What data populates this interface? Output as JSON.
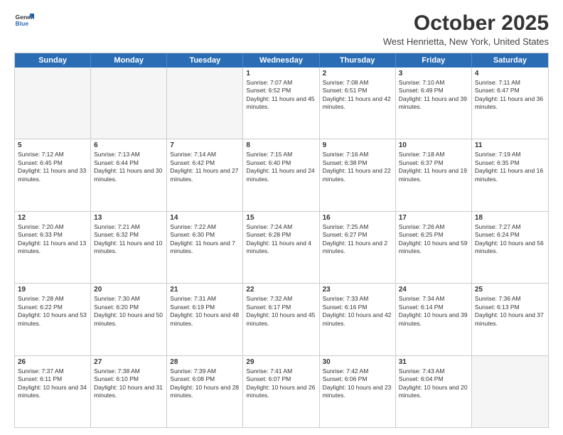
{
  "logo": {
    "line1": "General",
    "line2": "Blue"
  },
  "title": "October 2025",
  "location": "West Henrietta, New York, United States",
  "days_of_week": [
    "Sunday",
    "Monday",
    "Tuesday",
    "Wednesday",
    "Thursday",
    "Friday",
    "Saturday"
  ],
  "weeks": [
    [
      {
        "day": "",
        "text": ""
      },
      {
        "day": "",
        "text": ""
      },
      {
        "day": "",
        "text": ""
      },
      {
        "day": "1",
        "text": "Sunrise: 7:07 AM\nSunset: 6:52 PM\nDaylight: 11 hours and 45 minutes."
      },
      {
        "day": "2",
        "text": "Sunrise: 7:08 AM\nSunset: 6:51 PM\nDaylight: 11 hours and 42 minutes."
      },
      {
        "day": "3",
        "text": "Sunrise: 7:10 AM\nSunset: 6:49 PM\nDaylight: 11 hours and 39 minutes."
      },
      {
        "day": "4",
        "text": "Sunrise: 7:11 AM\nSunset: 6:47 PM\nDaylight: 11 hours and 36 minutes."
      }
    ],
    [
      {
        "day": "5",
        "text": "Sunrise: 7:12 AM\nSunset: 6:45 PM\nDaylight: 11 hours and 33 minutes."
      },
      {
        "day": "6",
        "text": "Sunrise: 7:13 AM\nSunset: 6:44 PM\nDaylight: 11 hours and 30 minutes."
      },
      {
        "day": "7",
        "text": "Sunrise: 7:14 AM\nSunset: 6:42 PM\nDaylight: 11 hours and 27 minutes."
      },
      {
        "day": "8",
        "text": "Sunrise: 7:15 AM\nSunset: 6:40 PM\nDaylight: 11 hours and 24 minutes."
      },
      {
        "day": "9",
        "text": "Sunrise: 7:16 AM\nSunset: 6:38 PM\nDaylight: 11 hours and 22 minutes."
      },
      {
        "day": "10",
        "text": "Sunrise: 7:18 AM\nSunset: 6:37 PM\nDaylight: 11 hours and 19 minutes."
      },
      {
        "day": "11",
        "text": "Sunrise: 7:19 AM\nSunset: 6:35 PM\nDaylight: 11 hours and 16 minutes."
      }
    ],
    [
      {
        "day": "12",
        "text": "Sunrise: 7:20 AM\nSunset: 6:33 PM\nDaylight: 11 hours and 13 minutes."
      },
      {
        "day": "13",
        "text": "Sunrise: 7:21 AM\nSunset: 6:32 PM\nDaylight: 11 hours and 10 minutes."
      },
      {
        "day": "14",
        "text": "Sunrise: 7:22 AM\nSunset: 6:30 PM\nDaylight: 11 hours and 7 minutes."
      },
      {
        "day": "15",
        "text": "Sunrise: 7:24 AM\nSunset: 6:28 PM\nDaylight: 11 hours and 4 minutes."
      },
      {
        "day": "16",
        "text": "Sunrise: 7:25 AM\nSunset: 6:27 PM\nDaylight: 11 hours and 2 minutes."
      },
      {
        "day": "17",
        "text": "Sunrise: 7:26 AM\nSunset: 6:25 PM\nDaylight: 10 hours and 59 minutes."
      },
      {
        "day": "18",
        "text": "Sunrise: 7:27 AM\nSunset: 6:24 PM\nDaylight: 10 hours and 56 minutes."
      }
    ],
    [
      {
        "day": "19",
        "text": "Sunrise: 7:28 AM\nSunset: 6:22 PM\nDaylight: 10 hours and 53 minutes."
      },
      {
        "day": "20",
        "text": "Sunrise: 7:30 AM\nSunset: 6:20 PM\nDaylight: 10 hours and 50 minutes."
      },
      {
        "day": "21",
        "text": "Sunrise: 7:31 AM\nSunset: 6:19 PM\nDaylight: 10 hours and 48 minutes."
      },
      {
        "day": "22",
        "text": "Sunrise: 7:32 AM\nSunset: 6:17 PM\nDaylight: 10 hours and 45 minutes."
      },
      {
        "day": "23",
        "text": "Sunrise: 7:33 AM\nSunset: 6:16 PM\nDaylight: 10 hours and 42 minutes."
      },
      {
        "day": "24",
        "text": "Sunrise: 7:34 AM\nSunset: 6:14 PM\nDaylight: 10 hours and 39 minutes."
      },
      {
        "day": "25",
        "text": "Sunrise: 7:36 AM\nSunset: 6:13 PM\nDaylight: 10 hours and 37 minutes."
      }
    ],
    [
      {
        "day": "26",
        "text": "Sunrise: 7:37 AM\nSunset: 6:11 PM\nDaylight: 10 hours and 34 minutes."
      },
      {
        "day": "27",
        "text": "Sunrise: 7:38 AM\nSunset: 6:10 PM\nDaylight: 10 hours and 31 minutes."
      },
      {
        "day": "28",
        "text": "Sunrise: 7:39 AM\nSunset: 6:08 PM\nDaylight: 10 hours and 28 minutes."
      },
      {
        "day": "29",
        "text": "Sunrise: 7:41 AM\nSunset: 6:07 PM\nDaylight: 10 hours and 26 minutes."
      },
      {
        "day": "30",
        "text": "Sunrise: 7:42 AM\nSunset: 6:06 PM\nDaylight: 10 hours and 23 minutes."
      },
      {
        "day": "31",
        "text": "Sunrise: 7:43 AM\nSunset: 6:04 PM\nDaylight: 10 hours and 20 minutes."
      },
      {
        "day": "",
        "text": ""
      }
    ]
  ]
}
